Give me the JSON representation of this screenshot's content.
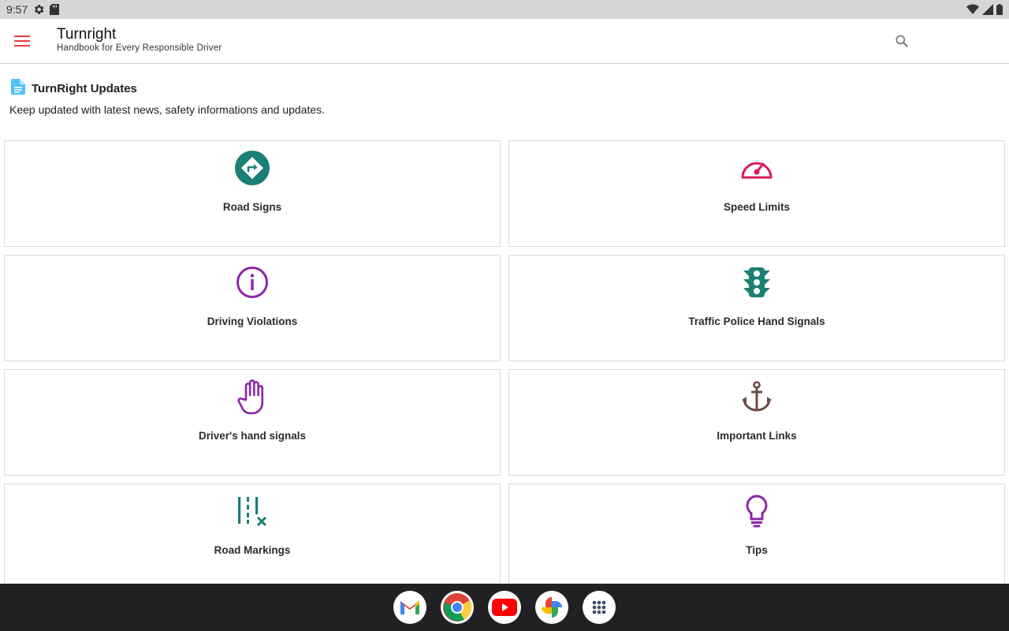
{
  "status_bar": {
    "time": "9:57",
    "icons": [
      "settings-gear-icon",
      "sd-card-icon",
      "wifi-icon",
      "cell-signal-icon",
      "battery-icon"
    ]
  },
  "app_bar": {
    "title": "Turnright",
    "subtitle": "Handbook for Every Responsible Driver",
    "menu_icon": "hamburger-menu-icon",
    "search_icon": "search-icon",
    "accent_color": "#e53935"
  },
  "updates": {
    "title": "TurnRight Updates",
    "description": "Keep updated with latest news, safety informations and updates.",
    "icon": "document-icon",
    "icon_color": "#4fc3f7"
  },
  "cards": [
    {
      "label": "Road Signs",
      "icon": "road-sign-turn-icon",
      "color": "#1a7f74"
    },
    {
      "label": "Speed Limits",
      "icon": "speedometer-icon",
      "color": "#d81b60"
    },
    {
      "label": "Driving Violations",
      "icon": "info-circle-icon",
      "color": "#8e24aa"
    },
    {
      "label": "Traffic Police Hand Signals",
      "icon": "traffic-light-icon",
      "color": "#1a7f74"
    },
    {
      "label": "Driver's hand signals",
      "icon": "hand-icon",
      "color": "#8e24aa"
    },
    {
      "label": "Important Links",
      "icon": "anchor-icon",
      "color": "#6d4c41"
    },
    {
      "label": "Road Markings",
      "icon": "road-markings-icon",
      "color": "#1a7f74"
    },
    {
      "label": "Tips",
      "icon": "lightbulb-icon",
      "color": "#8e24aa"
    }
  ],
  "dock": {
    "apps": [
      {
        "name": "Gmail",
        "icon": "gmail-icon"
      },
      {
        "name": "Chrome",
        "icon": "chrome-icon"
      },
      {
        "name": "YouTube",
        "icon": "youtube-icon"
      },
      {
        "name": "Photos",
        "icon": "photos-icon"
      },
      {
        "name": "App Drawer",
        "icon": "app-drawer-icon"
      }
    ]
  }
}
